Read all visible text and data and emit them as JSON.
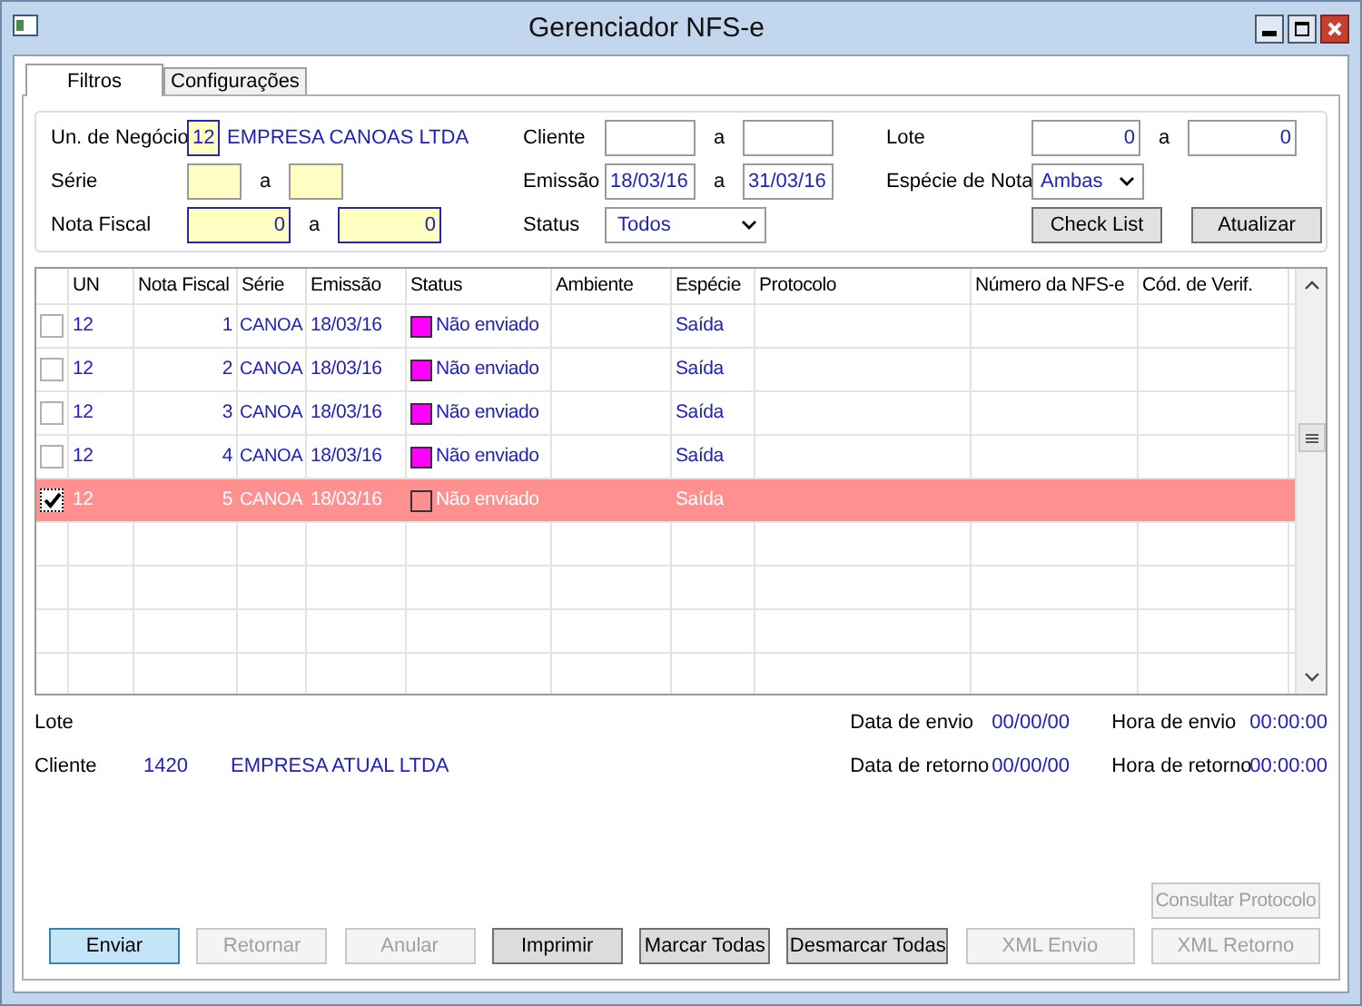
{
  "window": {
    "title": "Gerenciador NFS-e"
  },
  "tabs": [
    {
      "label": "Filtros",
      "selected": true
    },
    {
      "label": "Configurações",
      "selected": false
    }
  ],
  "filters": {
    "columns": [
      [
        {
          "kind": "unit",
          "label": "Un. de Negócio",
          "code": "12",
          "name": "EMPRESA CANOAS LTDA"
        },
        {
          "kind": "range",
          "label": "Série",
          "separator": "a",
          "highlighted": true
        },
        {
          "kind": "range",
          "label": "Nota Fiscal",
          "from": "0",
          "to": "0",
          "separator": "a",
          "highlighted": true
        }
      ],
      [
        {
          "kind": "range",
          "label": "Cliente",
          "separator": "a",
          "highlighted": false
        },
        {
          "kind": "range",
          "label": "Emissão",
          "from": "18/03/16",
          "to": "31/03/16",
          "separator": "a",
          "highlighted": false
        },
        {
          "kind": "select",
          "label": "Status",
          "value": "Todos"
        }
      ],
      [
        {
          "kind": "range",
          "label": "Lote",
          "from": "0",
          "to": "0",
          "separator": "a",
          "highlighted": false
        },
        {
          "kind": "select",
          "label": "Espécie de Nota",
          "value": "Ambas"
        },
        {
          "kind": "buttons",
          "buttons": [
            "Check List",
            "Atualizar"
          ]
        }
      ]
    ]
  },
  "table": {
    "columns": [
      "UN",
      "Nota Fiscal",
      "Série",
      "Emissão",
      "Status",
      "Ambiente",
      "Espécie",
      "Protocolo",
      "Número da NFS-e",
      "Cód. de Verif."
    ],
    "rows": [
      {
        "checked": false,
        "selected": false,
        "un": "12",
        "nota": "1",
        "serie": "CANOA",
        "emissao": "18/03/16",
        "status": "Não enviado",
        "color": "#ff00ff",
        "especie": "Saída"
      },
      {
        "checked": false,
        "selected": false,
        "un": "12",
        "nota": "2",
        "serie": "CANOA",
        "emissao": "18/03/16",
        "status": "Não enviado",
        "color": "#ff00ff",
        "especie": "Saída"
      },
      {
        "checked": false,
        "selected": false,
        "un": "12",
        "nota": "3",
        "serie": "CANOA",
        "emissao": "18/03/16",
        "status": "Não enviado",
        "color": "#ff00ff",
        "especie": "Saída"
      },
      {
        "checked": false,
        "selected": false,
        "un": "12",
        "nota": "4",
        "serie": "CANOA",
        "emissao": "18/03/16",
        "status": "Não enviado",
        "color": "#ff00ff",
        "especie": "Saída"
      },
      {
        "checked": true,
        "selected": true,
        "un": "12",
        "nota": "5",
        "serie": "CANOA",
        "emissao": "18/03/16",
        "status": "Não enviado",
        "color": "#ff8f8f",
        "especie": "Saída"
      }
    ]
  },
  "info": {
    "lote_label": "Lote",
    "cliente_label": "Cliente",
    "cliente_code": "1420",
    "cliente_name": "EMPRESA ATUAL LTDA",
    "data_envio_label": "Data de envio",
    "data_envio": "00/00/00",
    "hora_envio_label": "Hora de envio",
    "hora_envio": "00:00:00",
    "data_retorno_label": "Data de retorno",
    "data_retorno": "00/00/00",
    "hora_retorno_label": "Hora de retorno",
    "hora_retorno": "00:00:00"
  },
  "consultar": {
    "label": "Consultar Protocolo",
    "disabled": true
  },
  "buttons": [
    {
      "label": "Enviar",
      "disabled": false,
      "default": true
    },
    {
      "label": "Retornar",
      "disabled": true,
      "default": false
    },
    {
      "label": "Anular",
      "disabled": true,
      "default": false
    },
    {
      "label": "Imprimir",
      "disabled": false,
      "default": false
    },
    {
      "label": "Marcar Todas",
      "disabled": false,
      "default": false
    },
    {
      "label": "Desmarcar Todas",
      "disabled": false,
      "default": false
    },
    {
      "label": "XML Envio",
      "disabled": true,
      "default": false
    },
    {
      "label": "XML Retorno",
      "disabled": true,
      "default": false
    }
  ]
}
